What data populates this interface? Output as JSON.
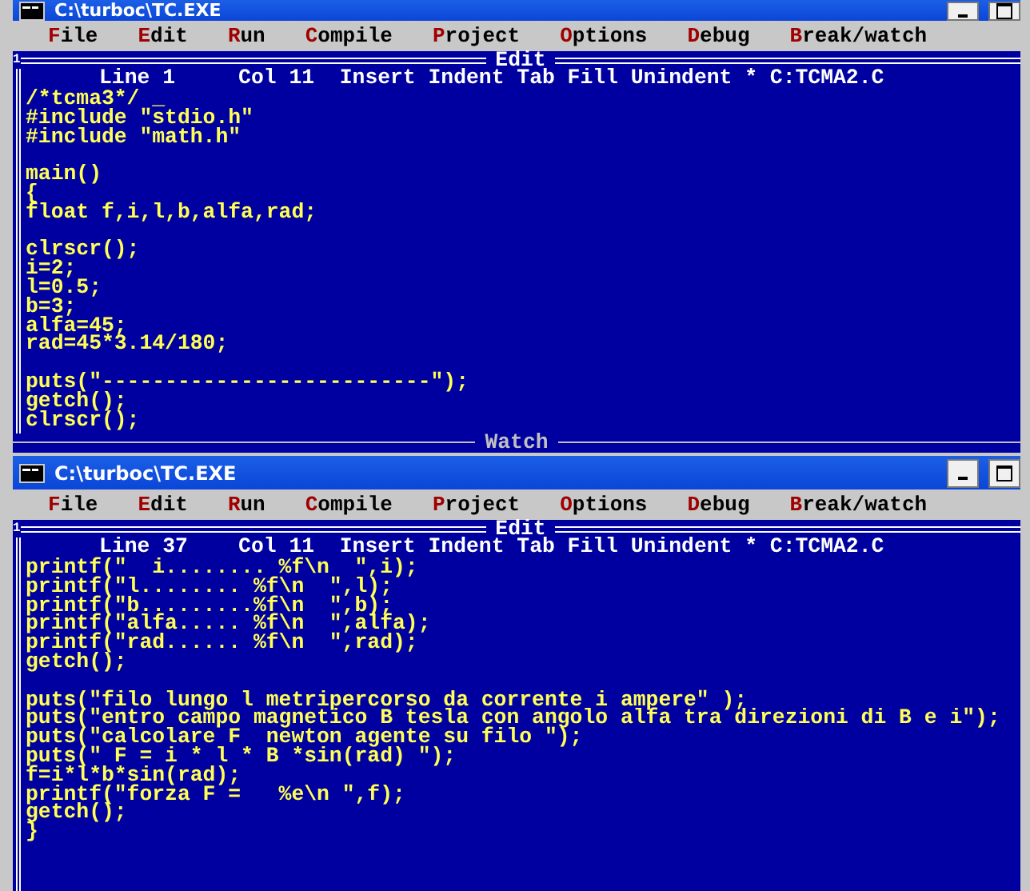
{
  "windows": [
    {
      "title": "C:\\turboc\\TC.EXE",
      "menu": [
        {
          "label": "File"
        },
        {
          "label": "Edit"
        },
        {
          "label": "Run"
        },
        {
          "label": "Compile"
        },
        {
          "label": "Project"
        },
        {
          "label": "Options"
        },
        {
          "label": "Debug"
        },
        {
          "label": "Break/watch"
        }
      ],
      "frame_number": "1",
      "frame_title": "Edit",
      "status_line": "Line 1     Col 11  Insert Indent Tab Fill Unindent * C:TCMA2.C",
      "code": "/*tcma3*/ _\n#include \"stdio.h\"\n#include \"math.h\"\n\nmain()\n{\nfloat f,i,l,b,alfa,rad;\n\nclrscr();\ni=2;\nl=0.5;\nb=3;\nalfa=45;\nrad=45*3.14/180;\n\nputs(\"--------------------------\");\ngetch();\nclrscr();",
      "bottom_title": "Watch"
    },
    {
      "title": "C:\\turboc\\TC.EXE",
      "menu": [
        {
          "label": "File"
        },
        {
          "label": "Edit"
        },
        {
          "label": "Run"
        },
        {
          "label": "Compile"
        },
        {
          "label": "Project"
        },
        {
          "label": "Options"
        },
        {
          "label": "Debug"
        },
        {
          "label": "Break/watch"
        }
      ],
      "frame_number": "1",
      "frame_title": "Edit",
      "status_line": "Line 37    Col 11  Insert Indent Tab Fill Unindent * C:TCMA2.C",
      "code": "printf(\"  i........ %f\\n  \",i);\nprintf(\"l........ %f\\n  \",l);\nprintf(\"b.........%f\\n  \",b);\nprintf(\"alfa..... %f\\n  \",alfa);\nprintf(\"rad...... %f\\n  \",rad);\ngetch();\n\nputs(\"filo lungo l metripercorso da corrente i ampere\" );\nputs(\"entro campo magnetico B tesla con angolo alfa tra direzioni di B e i\");\nputs(\"calcolare F  newton agente su filo \");\nputs(\" F = i * l * B *sin(rad) \");\nf=i*l*b*sin(rad);\nprintf(\"forza F =   %e\\n \",f);\ngetch();\n}"
    }
  ]
}
